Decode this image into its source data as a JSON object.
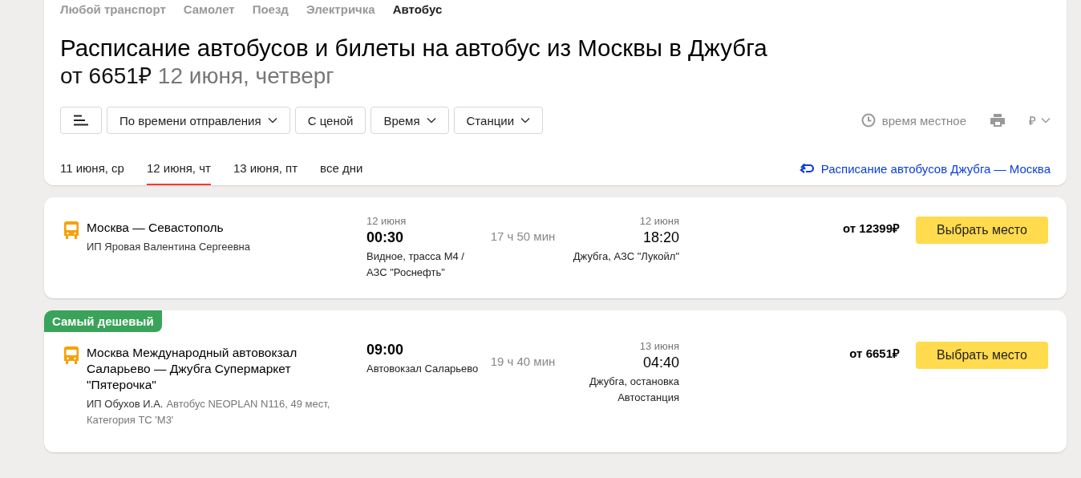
{
  "transport_tabs": [
    {
      "label": "Любой транспорт",
      "selected": false
    },
    {
      "label": "Самолет",
      "selected": false
    },
    {
      "label": "Поезд",
      "selected": false
    },
    {
      "label": "Электричка",
      "selected": false
    },
    {
      "label": "Автобус",
      "selected": true
    }
  ],
  "title": "Расписание автобусов и билеты на автобус из Москвы в Джубга",
  "subtitle": {
    "price": "от 6651₽",
    "date": "12 июня, четверг"
  },
  "filters": [
    {
      "kind": "icon"
    },
    {
      "kind": "dropdown",
      "label": "По времени отправления"
    },
    {
      "kind": "toggle",
      "label": "С ценой"
    },
    {
      "kind": "dropdown",
      "label": "Время"
    },
    {
      "kind": "dropdown",
      "label": "Станции"
    }
  ],
  "local_time": "время местное",
  "currency": "₽",
  "date_tabs": [
    {
      "label": "11 июня, ср",
      "selected": false
    },
    {
      "label": "12 июня, чт",
      "selected": true
    },
    {
      "label": "13 июня, пт",
      "selected": false
    },
    {
      "label": "все дни",
      "selected": false
    }
  ],
  "return_link": "Расписание автобусов Джубга — Москва",
  "trips": [
    {
      "route": "Москва — Севастополь",
      "carrier": "ИП Яровая Валентина Сергеевна",
      "departure": {
        "date": "12 июня",
        "time": "00:30",
        "station": "Видное, трасса М4 / АЗС \"Роснефть\""
      },
      "duration": "17 ч 50 мин",
      "arrival": {
        "date": "12 июня",
        "time": "18:20",
        "station": "Джубга, АЗС \"Лукойл\""
      },
      "price": "от 12399₽",
      "button": "Выбрать место"
    },
    {
      "badge": "Самый дешевый",
      "route": "Москва Международный автовокзал Саларьево — Джубга Супермаркет \"Пятерочка\"",
      "carrier": "ИП Обухов И.А.",
      "bus_info": "Автобус NEOPLAN N116, 49 мест, Категория ТС 'М3'",
      "departure": {
        "time": "09:00",
        "station": "Автовокзал Саларьево"
      },
      "duration": "19 ч 40 мин",
      "arrival": {
        "date": "13 июня",
        "time": "04:40",
        "station": "Джубга, остановка Автостанция"
      },
      "price": "от 6651₽",
      "button": "Выбрать место"
    }
  ]
}
